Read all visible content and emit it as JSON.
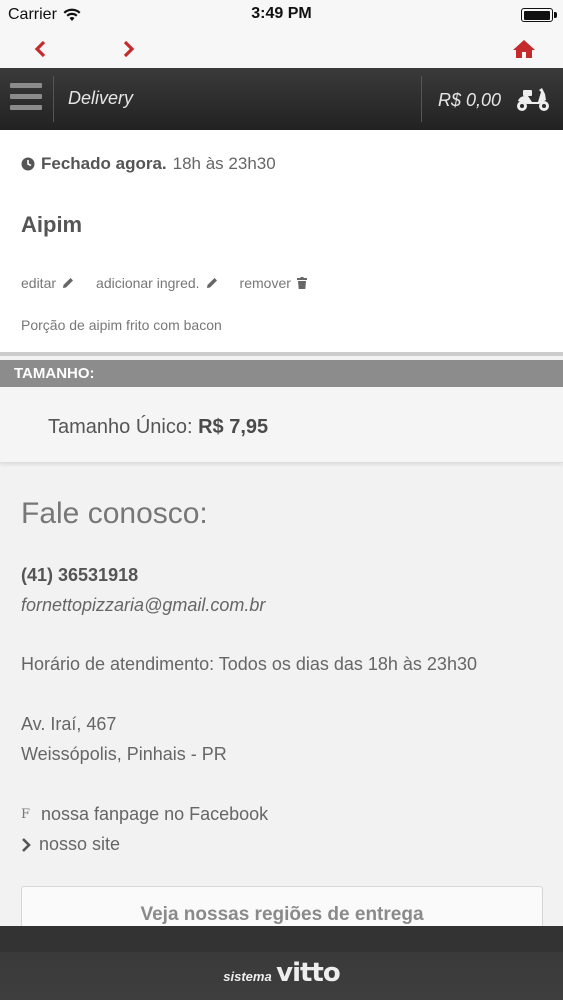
{
  "status_bar": {
    "carrier": "Carrier",
    "time": "3:49 PM"
  },
  "nav": {
    "back_icon": "chevron-left-icon",
    "forward_icon": "chevron-right-icon",
    "home_icon": "home-icon",
    "accent_color": "#c62b2b"
  },
  "header": {
    "title": "Delivery",
    "cart_total": "R$ 0,00",
    "cart_icon": "scooter-icon"
  },
  "store": {
    "status": "Fechado agora.",
    "hours": "18h às 23h30"
  },
  "product": {
    "name": "Aipim",
    "actions": {
      "edit": "editar",
      "add_ingredient": "adicionar ingred.",
      "remove": "remover"
    },
    "description": "Porção de aipim frito com bacon"
  },
  "size_section": {
    "header": "TAMANHO:",
    "label": "Tamanho Único:",
    "price": "R$ 7,95"
  },
  "contact": {
    "title": "Fale conosco:",
    "phone": "(41) 36531918",
    "email": "fornettopizzaria@gmail.com.br",
    "hours": "Horário de atendimento: Todos os dias das 18h às 23h30",
    "address_line1": "Av. Iraí, 467",
    "address_line2": "Weissópolis, Pinhais - PR",
    "facebook_icon": "F",
    "facebook": "nossa fanpage no Facebook",
    "site": "nosso site",
    "regions_button": "Veja nossas regiões de entrega"
  },
  "footer": {
    "brand_small": "sistema",
    "brand_big": "vitto"
  }
}
